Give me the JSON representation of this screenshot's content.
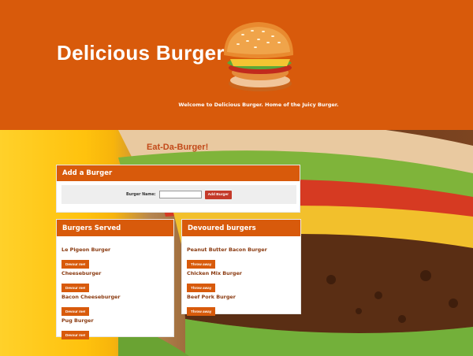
{
  "header": {
    "title": "Delicious Burger",
    "welcome": "Welcome to Delicious Burger. Home of the Juicy Burger."
  },
  "main": {
    "section_title": "Eat-Da-Burger!"
  },
  "add_panel": {
    "title": "Add a Burger",
    "label": "Burger Name:",
    "input_value": "",
    "button_label": "Add Burger"
  },
  "served": {
    "title": "Burgers Served",
    "action_label": "Devour me!",
    "items": [
      {
        "name": "Le Pigeon Burger"
      },
      {
        "name": "Cheeseburger"
      },
      {
        "name": "Bacon Cheeseburger"
      },
      {
        "name": "Pug Burger"
      }
    ]
  },
  "devoured": {
    "title": "Devoured burgers",
    "action_label": "Throw away",
    "items": [
      {
        "name": "Peanut Butter Bacon Burger"
      },
      {
        "name": "Chicken Mix Burger"
      },
      {
        "name": "Beef Pork Burger"
      }
    ]
  },
  "colors": {
    "brand": "#d85a0b",
    "add_button": "#c43a2a",
    "item_text": "#8a3a10"
  }
}
